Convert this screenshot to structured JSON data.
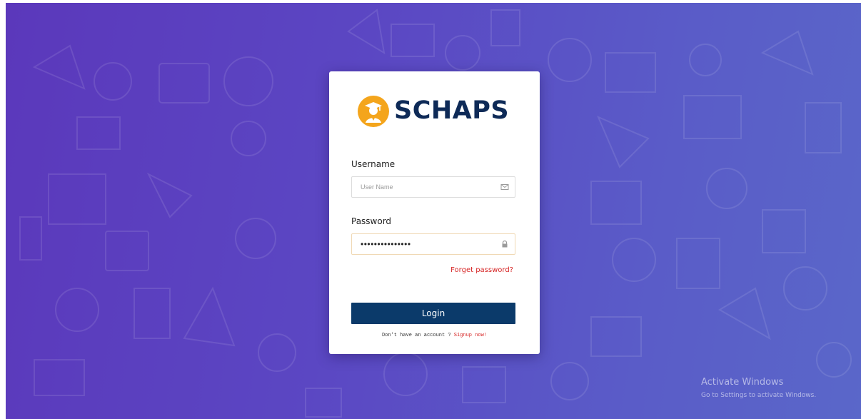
{
  "brand": {
    "name": "SCHAPS",
    "icon": "graduate-logo-icon",
    "colors": {
      "logo_badge": "#f4a51c",
      "logo_text": "#0e2a57"
    }
  },
  "form": {
    "username": {
      "label": "Username",
      "placeholder": "User Name",
      "value": "",
      "icon": "envelope-icon"
    },
    "password": {
      "label": "Password",
      "value": "•••••••••••••••",
      "icon": "lock-icon"
    },
    "forgot_label": "Forget password?",
    "login_label": "Login",
    "signup_prompt": "Don't have an account ? ",
    "signup_link": "Signup now!"
  },
  "colors": {
    "background_start": "#5b38bb",
    "background_end": "#5a67c9",
    "primary_button": "#0b3a6a",
    "link": "#d62424"
  },
  "watermark": {
    "title": "Activate Windows",
    "subtitle": "Go to Settings to activate Windows."
  }
}
